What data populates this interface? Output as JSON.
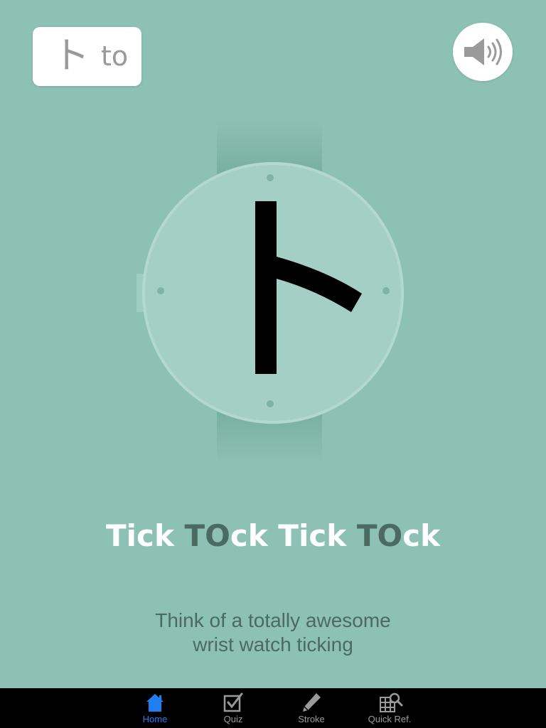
{
  "header": {
    "kana": "ト",
    "romaji": "to"
  },
  "sound_button": {
    "icon": "speaker-icon"
  },
  "watch": {
    "glyph": "ト",
    "crown_icon": "watch-crown"
  },
  "mnemonic": {
    "title_parts": [
      {
        "text": "Tick ",
        "highlight": false
      },
      {
        "text": "TO",
        "highlight": true
      },
      {
        "text": "ck Tick ",
        "highlight": false
      },
      {
        "text": "TO",
        "highlight": true
      },
      {
        "text": "ck",
        "highlight": false
      }
    ],
    "description_line1": "Think of a totally awesome",
    "description_line2": "wrist watch ticking"
  },
  "tab_bar": {
    "tabs": [
      {
        "label": "Home",
        "icon": "home-icon",
        "active": true
      },
      {
        "label": "Quiz",
        "icon": "checkbox-icon",
        "active": false
      },
      {
        "label": "Stroke",
        "icon": "pencil-icon",
        "active": false
      },
      {
        "label": "Quick Ref.",
        "icon": "grid-search-icon",
        "active": false
      }
    ]
  },
  "colors": {
    "background": "#8cc1b3",
    "watch_face": "#a4cfc4",
    "watch_band": "#7ab0a2",
    "highlight_text": "#4b6b61",
    "tab_active": "#1f7ff0",
    "tab_inactive": "#9a9a9a"
  }
}
